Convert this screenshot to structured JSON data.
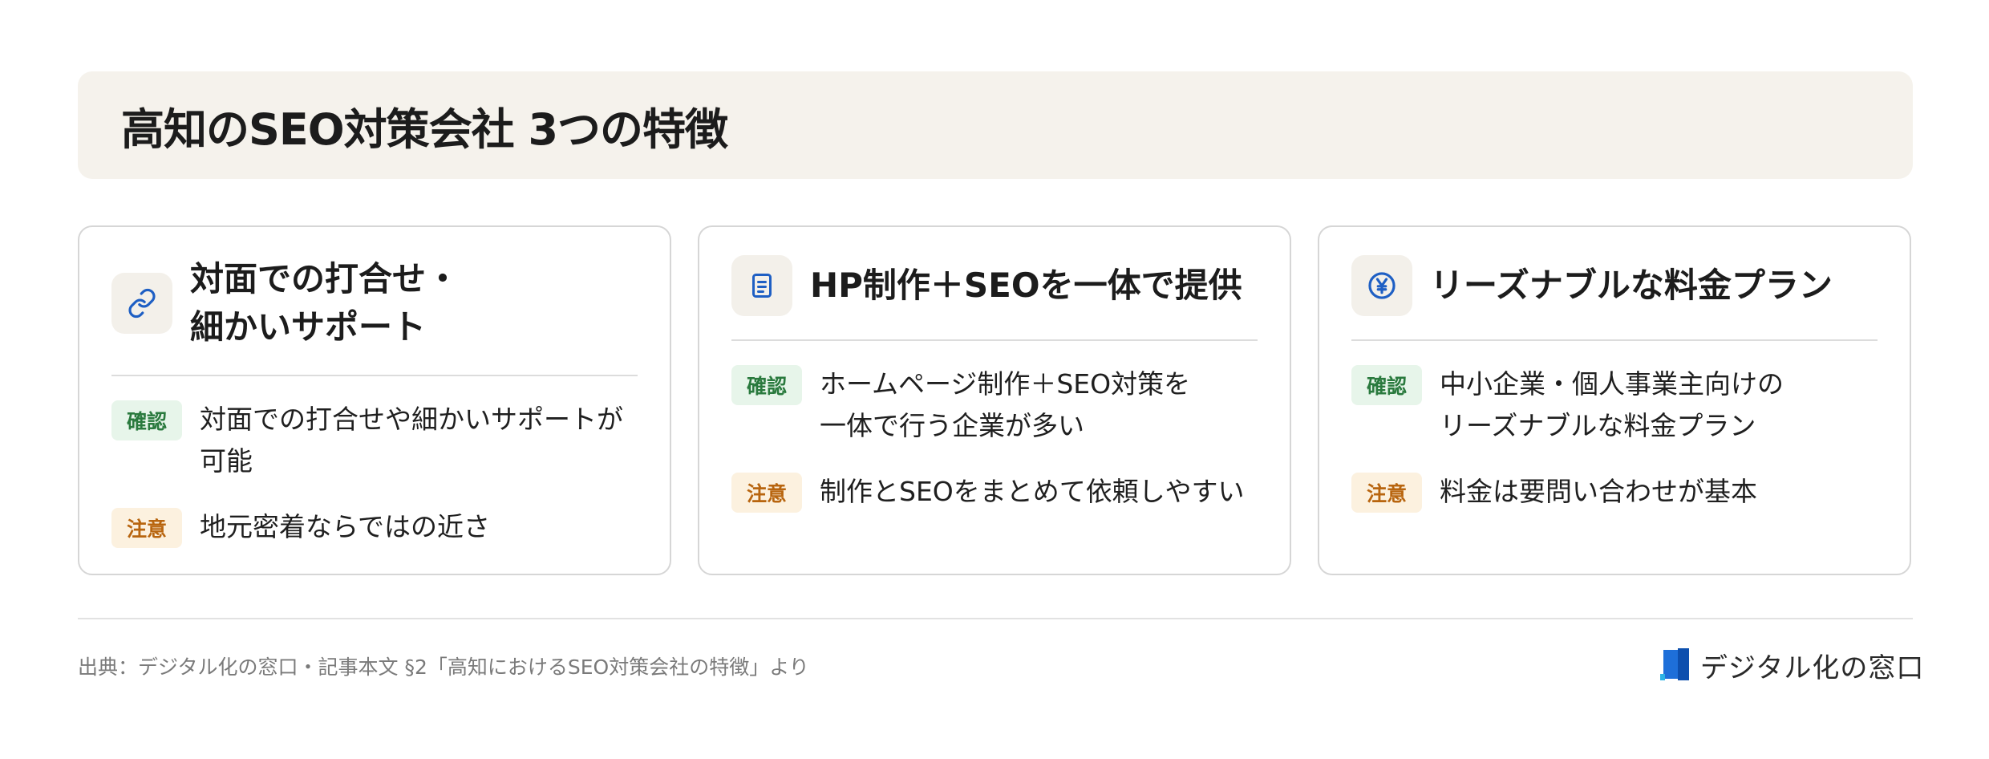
{
  "header": {
    "title": "高知のSEO対策会社 3つの特徴"
  },
  "cards": [
    {
      "icon": "link-icon",
      "title": "対面での打合せ・\n細かいサポート",
      "rows": [
        {
          "badge": "確認",
          "text": "対面での打合せや細かいサポートが\n可能"
        },
        {
          "badge": "注意",
          "text": "地元密着ならではの近さ"
        }
      ]
    },
    {
      "icon": "document-icon",
      "title": "HP制作＋SEOを一体で提供",
      "rows": [
        {
          "badge": "確認",
          "text": "ホームページ制作＋SEO対策を\n一体で行う企業が多い"
        },
        {
          "badge": "注意",
          "text": "制作とSEOをまとめて依頼しやすい"
        }
      ]
    },
    {
      "icon": "yen-icon",
      "title": "リーズナブルな料金プラン",
      "rows": [
        {
          "badge": "確認",
          "text": "中小企業・個人事業主向けの\nリーズナブルな料金プラン"
        },
        {
          "badge": "注意",
          "text": "料金は要問い合わせが基本"
        }
      ]
    }
  ],
  "footer": {
    "source": "出典：デジタル化の窓口・記事本文 §2「高知におけるSEO対策会社の特徴」より",
    "logo_text": "デジタル化の窓口"
  },
  "colors": {
    "title_bg": "#f5f2ec",
    "confirm_badge_bg": "#e7f5ea",
    "confirm_badge_text": "#2a7a3e",
    "caution_badge_bg": "#fcf1df",
    "caution_badge_text": "#b8650f",
    "icon_blue": "#1e5fc4"
  }
}
